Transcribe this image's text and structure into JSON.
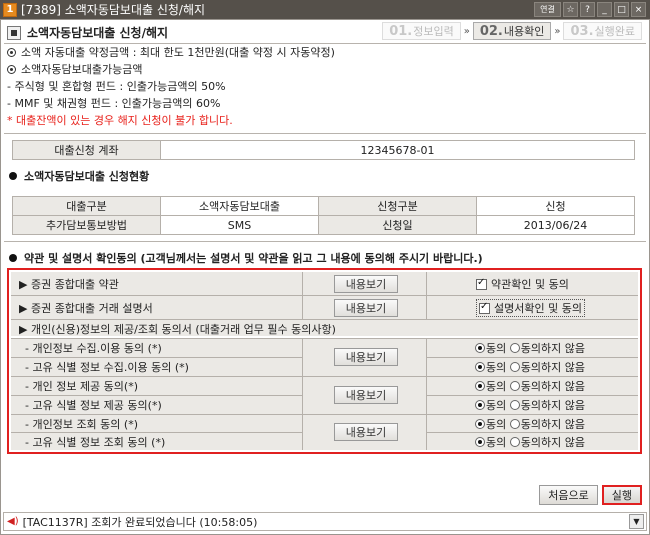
{
  "window": {
    "number": "1",
    "title": "[7389] 소액자동담보대출 신청/해지",
    "toolbar_icons": [
      "연결",
      "☆",
      "?",
      "_",
      "□",
      "×"
    ]
  },
  "page_title": "소액자동담보대출 신청/해지",
  "steps": [
    {
      "num": "01.",
      "label": "정보입력",
      "active": false
    },
    {
      "num": "02.",
      "label": "내용확인",
      "active": true
    },
    {
      "num": "03.",
      "label": "실행완료",
      "active": false
    }
  ],
  "info": {
    "line1": "소액 자동대출 약정금액 : 최대 한도 1천만원(대출 약정 시 자동약정)",
    "line2": "소액자동담보대출가능금액",
    "line3": "- 주식형 및 혼합형 펀드 : 인출가능금액의 50%",
    "line4": "- MMF 및 채권형 펀드 : 인출가능금액의 60%",
    "warning": "* 대출잔액이 있는 경우 해지 신청이 불가 합니다."
  },
  "account": {
    "label": "대출신청 계좌",
    "value": "12345678-01"
  },
  "status_section": {
    "title": "소액자동담보대출 신청현황",
    "rows": [
      [
        "대출구분",
        "소액자동담보대출",
        "신청구분",
        "신청"
      ],
      [
        "추가담보통보방법",
        "SMS",
        "신청일",
        "2013/06/24"
      ]
    ]
  },
  "terms_section": {
    "title": "약관 및 설명서 확인동의 (고객님께서는 설명서 및 약관을 읽고 그 내용에 동의해 주시기 바랍니다.)",
    "view_button": "내용보기",
    "items": [
      {
        "label": "▶ 증권 종합대출 약관",
        "check_label": "약관확인 및 동의"
      },
      {
        "label": "▶ 증권 종합대출 거래 설명서",
        "check_label": "설명서확인 및 동의"
      }
    ],
    "privacy_header": "▶ 개인(신용)정보의 제공/조회 동의서 (대출거래 업무 필수 동의사항)",
    "privacy_rows": [
      "- 개인정보 수집.이용 동의 (*)",
      "- 고유 식별 정보 수집.이용 동의 (*)",
      "- 개인 정보 제공 동의(*)",
      "- 고유 식별 정보 제공 동의(*)",
      "- 개인정보 조회 동의 (*)",
      "- 고유 식별 정보 조회 동의 (*)"
    ],
    "agree": "동의",
    "disagree": "동의하지 않음"
  },
  "buttons": {
    "reset": "처음으로",
    "execute": "실행"
  },
  "status_bar": {
    "icon": "◀)",
    "message": "[TAC1137R] 조회가 완료되었습니다 (10:58:05)"
  }
}
